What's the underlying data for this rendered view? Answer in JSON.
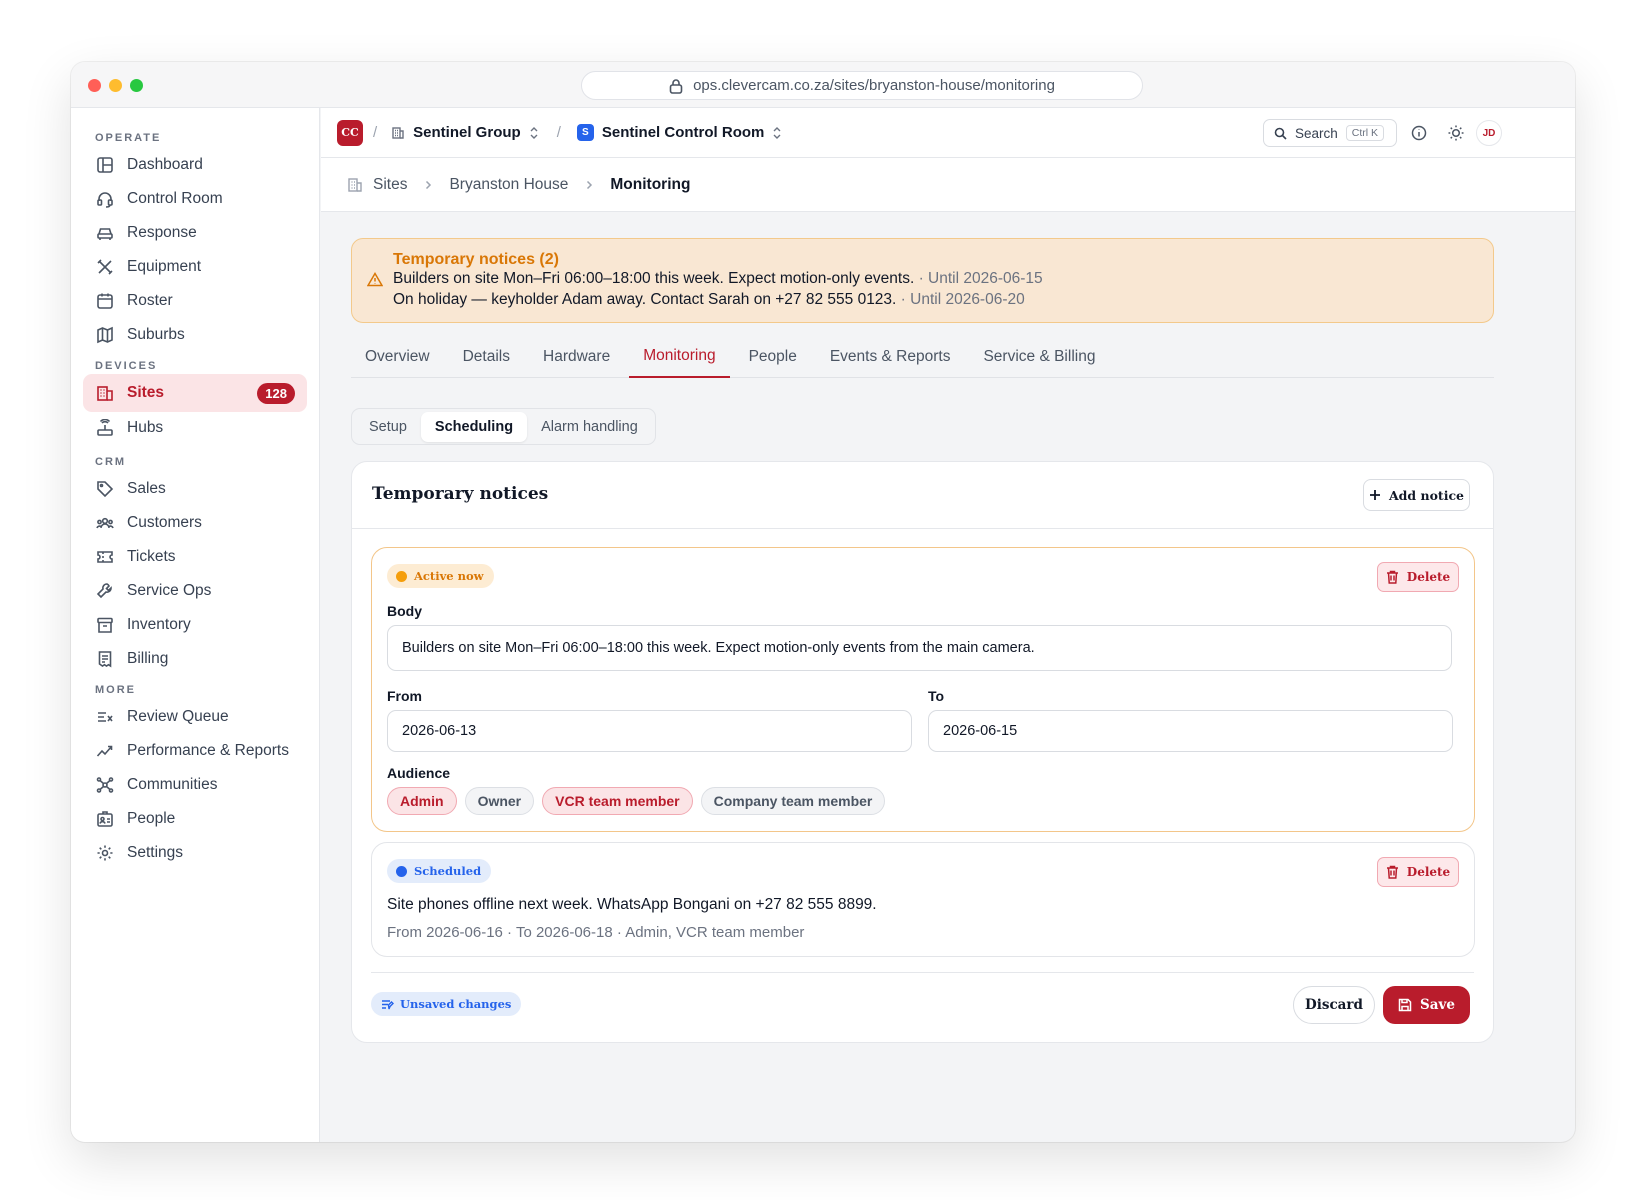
{
  "browser": {
    "url": "ops.clevercam.co.za/sites/bryanston-house/monitoring"
  },
  "sidebar": {
    "sections": [
      {
        "label": "OPERATE",
        "items": [
          {
            "label": "Dashboard",
            "icon": "layout-icon"
          },
          {
            "label": "Control Room",
            "icon": "headset-icon"
          },
          {
            "label": "Response",
            "icon": "car-icon"
          },
          {
            "label": "Equipment",
            "icon": "tools-icon"
          },
          {
            "label": "Roster",
            "icon": "calendar-icon"
          },
          {
            "label": "Suburbs",
            "icon": "map-icon"
          }
        ]
      },
      {
        "label": "DEVICES",
        "items": [
          {
            "label": "Sites",
            "icon": "building-icon",
            "active": true,
            "badge": "128"
          },
          {
            "label": "Hubs",
            "icon": "router-icon"
          }
        ]
      },
      {
        "label": "CRM",
        "items": [
          {
            "label": "Sales",
            "icon": "tag-icon"
          },
          {
            "label": "Customers",
            "icon": "users-icon"
          },
          {
            "label": "Tickets",
            "icon": "ticket-icon"
          },
          {
            "label": "Service Ops",
            "icon": "wrench-icon"
          },
          {
            "label": "Inventory",
            "icon": "archive-icon"
          },
          {
            "label": "Billing",
            "icon": "receipt-icon"
          }
        ]
      },
      {
        "label": "MORE",
        "items": [
          {
            "label": "Review Queue",
            "icon": "review-icon"
          },
          {
            "label": "Performance & Reports",
            "icon": "trend-icon"
          },
          {
            "label": "Communities",
            "icon": "network-icon"
          },
          {
            "label": "People",
            "icon": "id-badge-icon"
          },
          {
            "label": "Settings",
            "icon": "gear-icon"
          }
        ]
      }
    ]
  },
  "topbar": {
    "logo": "CC",
    "separator": "/",
    "org": "Sentinel Group",
    "workspace_initial": "S",
    "workspace": "Sentinel Control Room",
    "search_label": "Search",
    "search_shortcut": "Ctrl K",
    "avatar": "JD"
  },
  "breadcrumb": {
    "items": [
      "Sites",
      "Bryanston House",
      "Monitoring"
    ]
  },
  "banner": {
    "title": "Temporary notices (2)",
    "lines": [
      {
        "text": "Builders on site Mon–Fri 06:00–18:00 this week. Expect motion-only events.",
        "until": "· Until 2026-06-15"
      },
      {
        "text": "On holiday — keyholder Adam away. Contact Sarah on +27 82 555 0123.",
        "until": "· Until 2026-06-20"
      }
    ]
  },
  "tabs": [
    "Overview",
    "Details",
    "Hardware",
    "Monitoring",
    "People",
    "Events & Reports",
    "Service & Billing"
  ],
  "active_tab": "Monitoring",
  "subtabs": [
    "Setup",
    "Scheduling",
    "Alarm handling"
  ],
  "active_subtab": "Scheduling",
  "card": {
    "title": "Temporary notices",
    "add_label": "Add notice",
    "notice1": {
      "status": "Active now",
      "delete_label": "Delete",
      "body_label": "Body",
      "body_value": "Builders on site Mon–Fri 06:00–18:00 this week. Expect motion-only events from the main camera.",
      "from_label": "From",
      "from_value": "2026-06-13",
      "to_label": "To",
      "to_value": "2026-06-15",
      "audience_label": "Audience",
      "audience": [
        {
          "label": "Admin",
          "selected": true
        },
        {
          "label": "Owner",
          "selected": false
        },
        {
          "label": "VCR team member",
          "selected": true
        },
        {
          "label": "Company team member",
          "selected": false
        }
      ]
    },
    "notice2": {
      "status": "Scheduled",
      "delete_label": "Delete",
      "text": "Site phones offline next week. WhatsApp Bongani on +27 82 555 8899.",
      "meta": "From 2026-06-16 · To 2026-06-18 · Admin, VCR team member"
    },
    "unsaved_label": "Unsaved changes",
    "discard_label": "Discard",
    "save_label": "Save"
  },
  "colors": {
    "accent": "#b91c2c",
    "warning": "#f59e0b",
    "info": "#2563eb"
  }
}
